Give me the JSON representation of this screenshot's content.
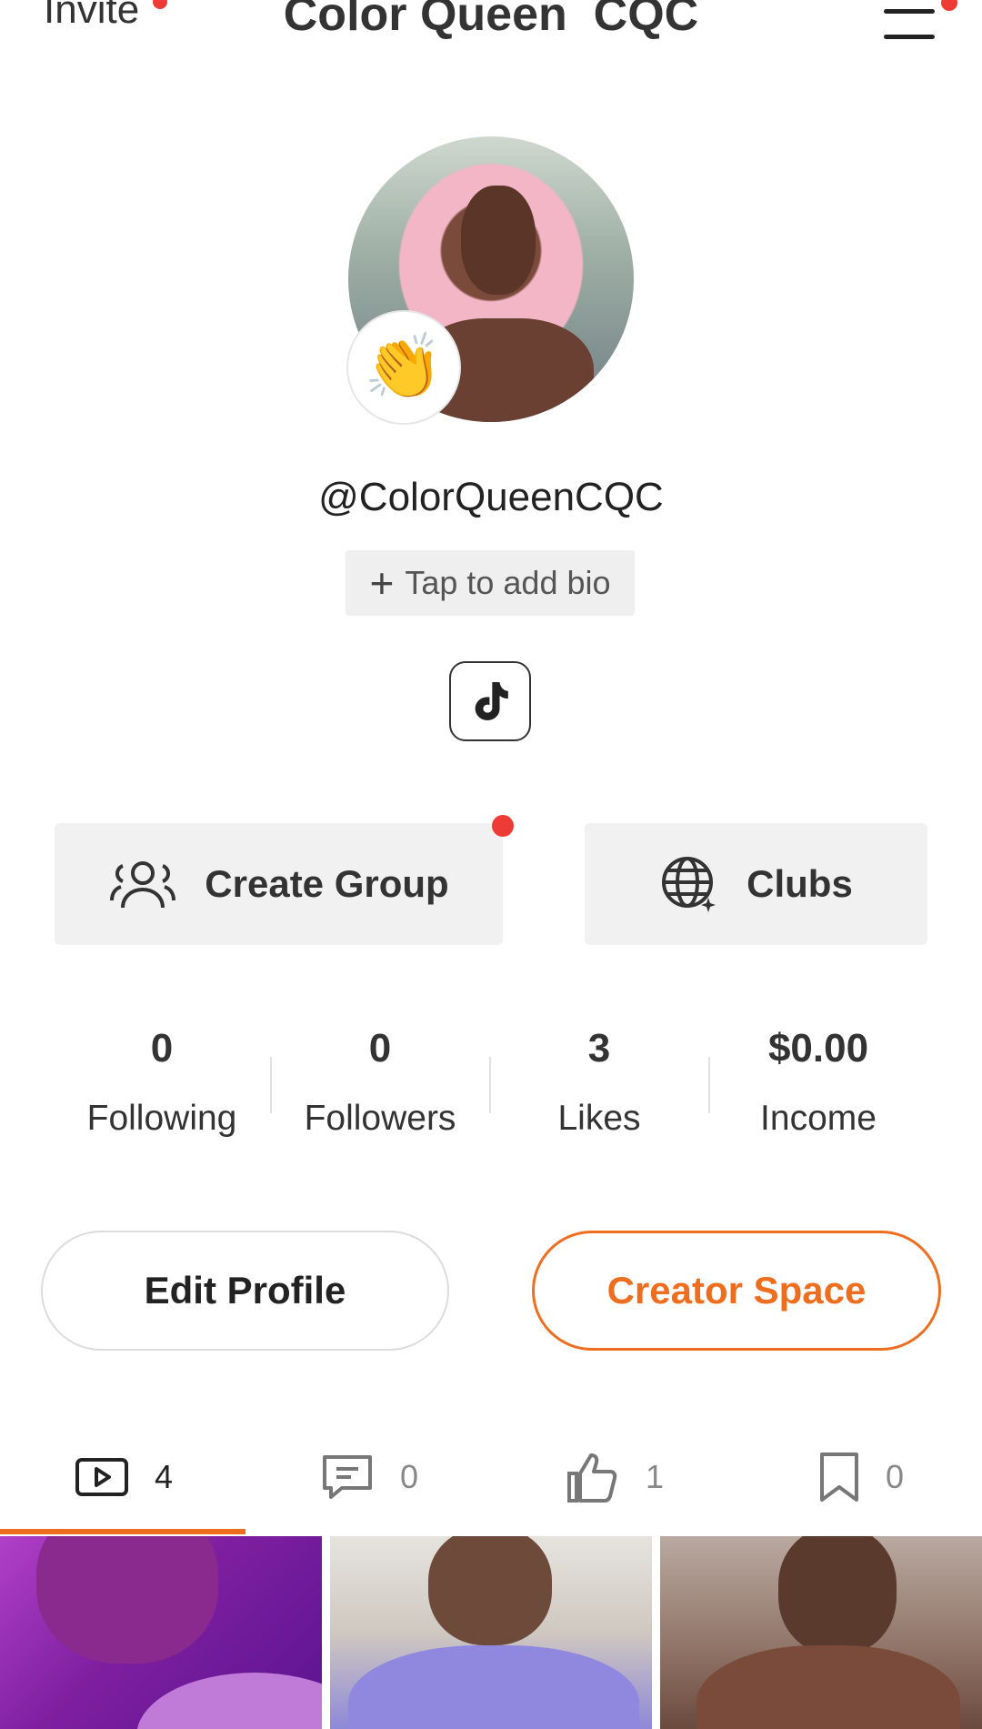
{
  "header": {
    "invite_label": "Invite",
    "title": "Color Queen  CQC"
  },
  "profile": {
    "handle": "@ColorQueenCQC",
    "badge_emoji": "👏",
    "bio_placeholder": "Tap to add bio",
    "bio_plus": "+"
  },
  "actions": {
    "create_group": "Create Group",
    "clubs": "Clubs"
  },
  "stats": [
    {
      "value": "0",
      "label": "Following"
    },
    {
      "value": "0",
      "label": "Followers"
    },
    {
      "value": "3",
      "label": "Likes"
    },
    {
      "value": "$0.00",
      "label": "Income"
    }
  ],
  "buttons": {
    "edit_profile": "Edit Profile",
    "creator_space": "Creator Space"
  },
  "tabs": [
    {
      "icon": "video-icon",
      "count": "4",
      "active": true
    },
    {
      "icon": "comment-icon",
      "count": "0",
      "active": false
    },
    {
      "icon": "thumbs-up-icon",
      "count": "1",
      "active": false
    },
    {
      "icon": "bookmark-icon",
      "count": "0",
      "active": false
    }
  ],
  "colors": {
    "accent": "#ee6e1f",
    "notification_dot": "#ef3b36",
    "button_bg": "#f1f1f1"
  }
}
